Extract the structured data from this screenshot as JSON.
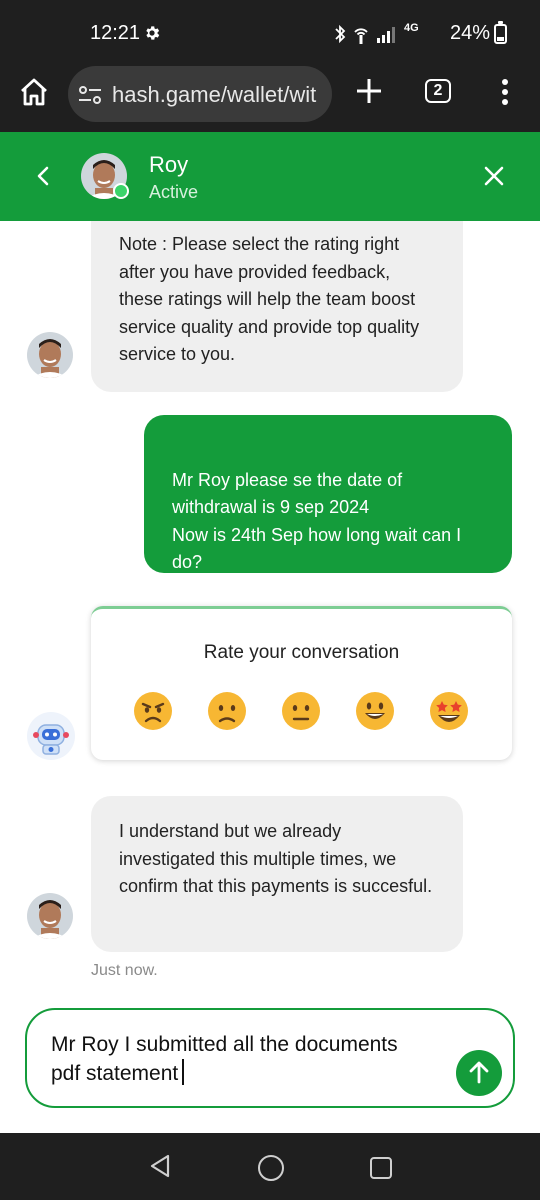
{
  "status_bar": {
    "time": "12:21",
    "battery": "24%",
    "network": "4G"
  },
  "browser": {
    "url": "hash.game/wallet/wit",
    "tab_count": "2"
  },
  "chat_header": {
    "agent_name": "Roy",
    "agent_status": "Active"
  },
  "messages": [
    {
      "sender": "agent",
      "text": "Note : Please select the rating right after you have provided feedback, these ratings will help the team boost service quality and provide top quality service to you."
    },
    {
      "sender": "user",
      "text": "Mr Roy please se the date of withdrawal is 9 sep 2024\nNow is 24th Sep how long wait can I do?"
    },
    {
      "sender": "agent",
      "text": "I understand but we already investigated this multiple times, we confirm that this payments is succesful."
    }
  ],
  "rating": {
    "title": "Rate your conversation",
    "options": [
      "very-dissatisfied",
      "dissatisfied",
      "neutral",
      "satisfied",
      "very-satisfied"
    ]
  },
  "timestamp": "Just now.",
  "composer": {
    "value": "Mr Roy I submitted all the documents pdf statement"
  },
  "colors": {
    "brand_green": "#149c3b",
    "bubble_gray": "#efefef",
    "bar_dark": "#1f1f1f"
  }
}
